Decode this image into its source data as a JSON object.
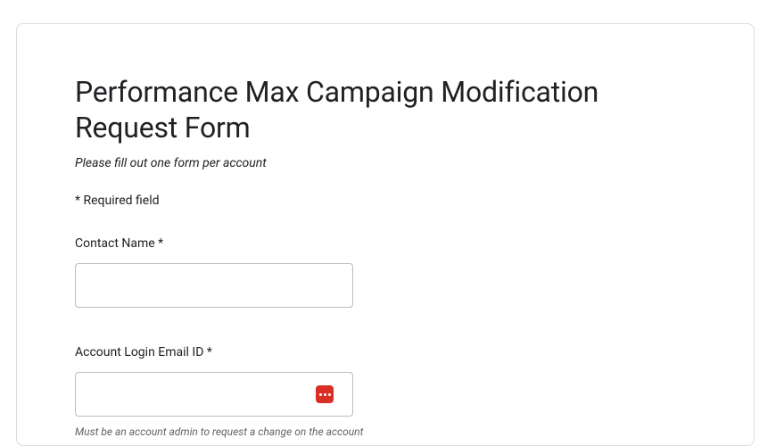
{
  "form": {
    "title": "Performance Max Campaign Modification Request Form",
    "subtitle": "Please fill out one form per account",
    "required_note": "* Required field",
    "fields": {
      "contact_name": {
        "label": "Contact Name *",
        "value": ""
      },
      "account_email": {
        "label": "Account Login Email ID *",
        "value": "",
        "helper": "Must be an account admin to request a change on the account"
      }
    }
  }
}
